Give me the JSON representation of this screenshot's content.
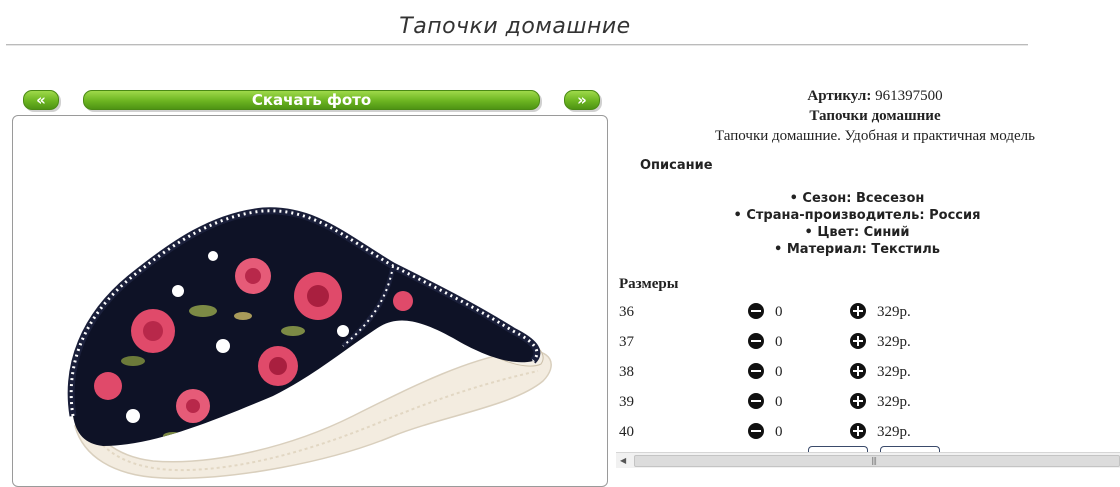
{
  "page": {
    "title": "Тапочки домашние"
  },
  "nav": {
    "prev_label": "«",
    "next_label": "»",
    "download_label": "Скачать фото"
  },
  "product": {
    "article_label": "Артикул:",
    "article_value": "961397500",
    "name": "Тапочки домашние",
    "short_desc": "Тапочки домашние. Удобная и практичная модель",
    "description_heading": "Описание",
    "properties": [
      "Сезон: Всесезон",
      "Страна-производитель: Россия",
      "Цвет: Синий",
      "Материал: Текстиль"
    ]
  },
  "sizes": {
    "heading": "Размеры",
    "rows": [
      {
        "size": "36",
        "qty": "0",
        "price": "329р."
      },
      {
        "size": "37",
        "qty": "0",
        "price": "329р."
      },
      {
        "size": "38",
        "qty": "0",
        "price": "329р."
      },
      {
        "size": "39",
        "qty": "0",
        "price": "329р."
      },
      {
        "size": "40",
        "qty": "0",
        "price": "329р."
      }
    ]
  },
  "colors": {
    "button_green": "#6cb521",
    "slipper_fabric": "#0e1226",
    "rose": "#e04a6a",
    "sole": "#f3ece0"
  },
  "icons": {
    "minus": "minus-circle-icon",
    "plus": "plus-circle-icon"
  }
}
